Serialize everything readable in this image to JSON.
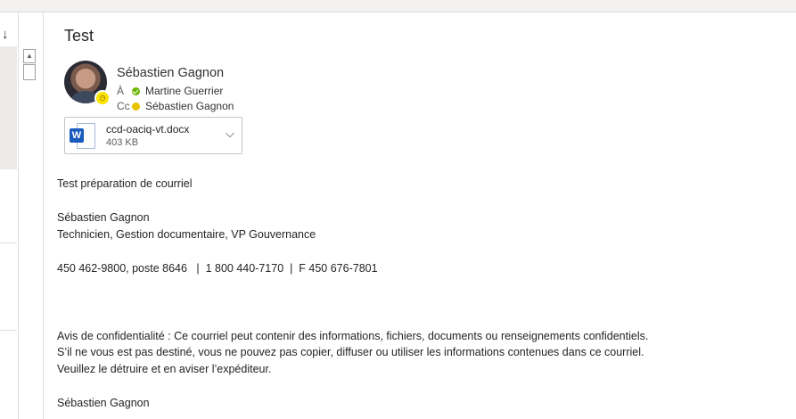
{
  "message": {
    "subject": "Test",
    "sender": "Sébastien Gagnon",
    "to_label": "À",
    "to": "Martine Guerrier",
    "cc_label": "Cc",
    "cc": "Sébastien Gagnon"
  },
  "attachment": {
    "name": "ccd-oaciq-vt.docx",
    "size": "403 KB",
    "icon": "word-icon"
  },
  "body": {
    "line1": "Test préparation de courriel",
    "sig_name": "Sébastien Gagnon",
    "sig_title": "Technicien, Gestion documentaire, VP Gouvernance",
    "sig_phone": "450 462-9800, poste 8646   |  1 800 440-7170  |  F 450 676-7801",
    "disclaimer1": "Avis de confidentialité : Ce courriel peut contenir des informations, fichiers, documents ou renseignements confidentiels.",
    "disclaimer2": "S’il ne vous est pas destiné, vous ne pouvez pas copier, diffuser ou utiliser les informations contenues dans ce courriel.",
    "disclaimer3": "Veuillez le détruire et en aviser l’expéditeur.",
    "closing_name": "Sébastien Gagnon"
  },
  "icons": {
    "sort": "arrow-down-icon",
    "scroll_up": "scroll-up-arrow-icon",
    "presence_away": "clock-icon",
    "status_available": "check-circle-icon",
    "status_away": "away-dot-icon"
  },
  "colors": {
    "word_blue": "#185abd",
    "available_green": "#6bb700",
    "away_yellow": "#e8c100"
  }
}
